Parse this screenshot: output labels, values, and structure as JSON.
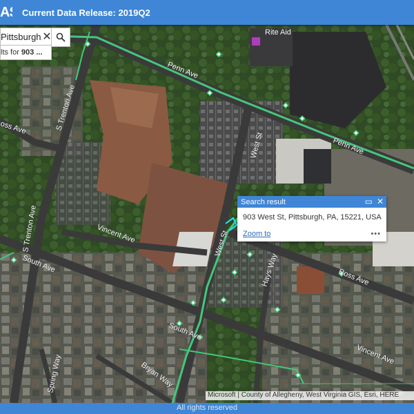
{
  "app": {
    "logo_text": "AS",
    "release_label": "Current Data Release: 2019Q2"
  },
  "search": {
    "value": "Pittsburgh, P",
    "suggestion_prefix": "lts for",
    "suggestion_term": "903 ...",
    "clear_icon": "close-icon",
    "search_icon": "search-icon"
  },
  "map": {
    "streets": [
      "Penn Ave",
      "S Trenton Ave",
      "West St",
      "Vincent Ave",
      "South Ave",
      "Ross Ave",
      "Hays Way",
      "Spring Way",
      "Bryan Way",
      "S Trenton Ave",
      "oss Ave"
    ],
    "poi": "Rite Aid",
    "attribution": "Microsoft | County of Allegheny, West Virginia GIS, Esri, HERE"
  },
  "popup": {
    "title": "Search result",
    "address": "903 West St, Pittsburgh, PA, 15221, USA",
    "zoom_label": "Zoom to",
    "more_label": "•••",
    "maximize_icon": "maximize-icon",
    "close_icon": "close-icon"
  },
  "footer": {
    "text": "All rights reserved"
  }
}
